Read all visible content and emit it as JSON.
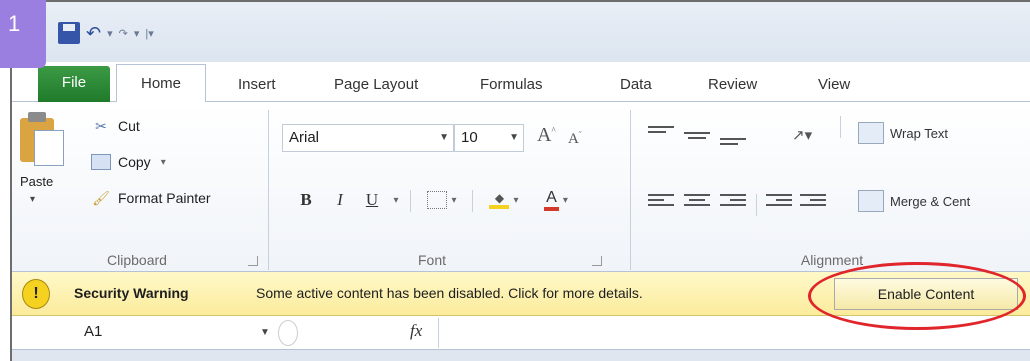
{
  "step_badge": "1",
  "quick_access": {
    "icons": [
      "save-icon",
      "undo-icon",
      "redo-icon",
      "customize-icon"
    ]
  },
  "tabs": [
    {
      "label": "File"
    },
    {
      "label": "Home"
    },
    {
      "label": "Insert"
    },
    {
      "label": "Page Layout"
    },
    {
      "label": "Formulas"
    },
    {
      "label": "Data"
    },
    {
      "label": "Review"
    },
    {
      "label": "View"
    }
  ],
  "ribbon": {
    "clipboard": {
      "paste": "Paste",
      "cut": "Cut",
      "copy": "Copy",
      "format_painter": "Format Painter",
      "label": "Clipboard"
    },
    "font": {
      "name": "Arial",
      "size": "10",
      "bold": "B",
      "italic": "I",
      "underline": "U",
      "label": "Font"
    },
    "alignment": {
      "wrap_text": "Wrap Text",
      "merge_center": "Merge & Cent",
      "label": "Alignment"
    }
  },
  "security_bar": {
    "title": "Security Warning",
    "message": "Some active content has been disabled. Click for more details.",
    "button": "Enable Content",
    "warn_symbol": "!"
  },
  "formula_bar": {
    "name_box": "A1",
    "fx": "fx"
  },
  "colors": {
    "badge": "#9a7fe0",
    "file_tab": "#2a8a35",
    "warning_bar": "#fbeb9c",
    "highlight_ring": "#e0252b"
  }
}
